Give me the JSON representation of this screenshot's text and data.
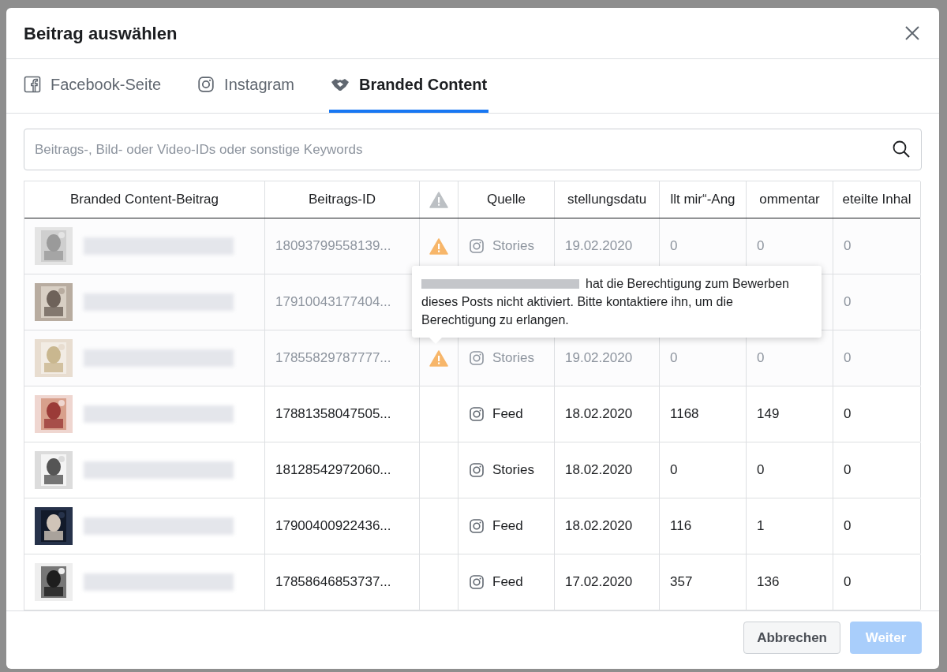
{
  "dialog": {
    "title": "Beitrag auswählen"
  },
  "tabs": [
    {
      "label": "Facebook-Seite",
      "kind": "facebook",
      "selected": false
    },
    {
      "label": "Instagram",
      "kind": "instagram",
      "selected": false
    },
    {
      "label": "Branded Content",
      "kind": "handshake",
      "selected": true
    }
  ],
  "search": {
    "placeholder": "Beitrags-, Bild- oder Video-IDs oder sonstige Keywords"
  },
  "table": {
    "columns": [
      {
        "label": "Branded Content-Beitrag",
        "kind": "text"
      },
      {
        "label": "Beitrags-ID",
        "kind": "text"
      },
      {
        "kind": "warning"
      },
      {
        "label": "Quelle",
        "kind": "text"
      },
      {
        "label": "stellungsdatu",
        "kind": "text"
      },
      {
        "label": "llt mir“-Ang",
        "kind": "text"
      },
      {
        "label": "ommentar",
        "kind": "text"
      },
      {
        "label": "eteilte Inhal",
        "kind": "text"
      }
    ],
    "rows": [
      {
        "disabled": true,
        "id": "18093799558139...",
        "warning": true,
        "source": "Stories",
        "date": "19.02.2020",
        "likes": "0",
        "comments": "0",
        "shares": "0"
      },
      {
        "disabled": true,
        "id": "17910043177404...",
        "shares": "0"
      },
      {
        "disabled": true,
        "id": "17855829787777...",
        "warning": true,
        "source": "Stories",
        "date": "19.02.2020",
        "likes": "0",
        "comments": "0",
        "shares": "0"
      },
      {
        "disabled": false,
        "id": "17881358047505...",
        "warning": false,
        "source": "Feed",
        "date": "18.02.2020",
        "likes": "1168",
        "comments": "149",
        "shares": "0"
      },
      {
        "disabled": false,
        "id": "18128542972060...",
        "warning": false,
        "source": "Stories",
        "date": "18.02.2020",
        "likes": "0",
        "comments": "0",
        "shares": "0"
      },
      {
        "disabled": false,
        "id": "17900400922436...",
        "warning": false,
        "source": "Feed",
        "date": "18.02.2020",
        "likes": "116",
        "comments": "1",
        "shares": "0"
      },
      {
        "disabled": false,
        "id": "17858646853737...",
        "warning": false,
        "source": "Feed",
        "date": "17.02.2020",
        "likes": "357",
        "comments": "136",
        "shares": "0"
      }
    ]
  },
  "tooltip": {
    "text": "hat die Berechtigung zum Bewerben dieses Posts nicht aktiviert. Bitte kontaktiere ihn, um die Berechtigung zu erlangen."
  },
  "buttons": [
    {
      "label": "Abbrechen",
      "disabled": false
    },
    {
      "label": "Weiter",
      "disabled": true
    }
  ]
}
